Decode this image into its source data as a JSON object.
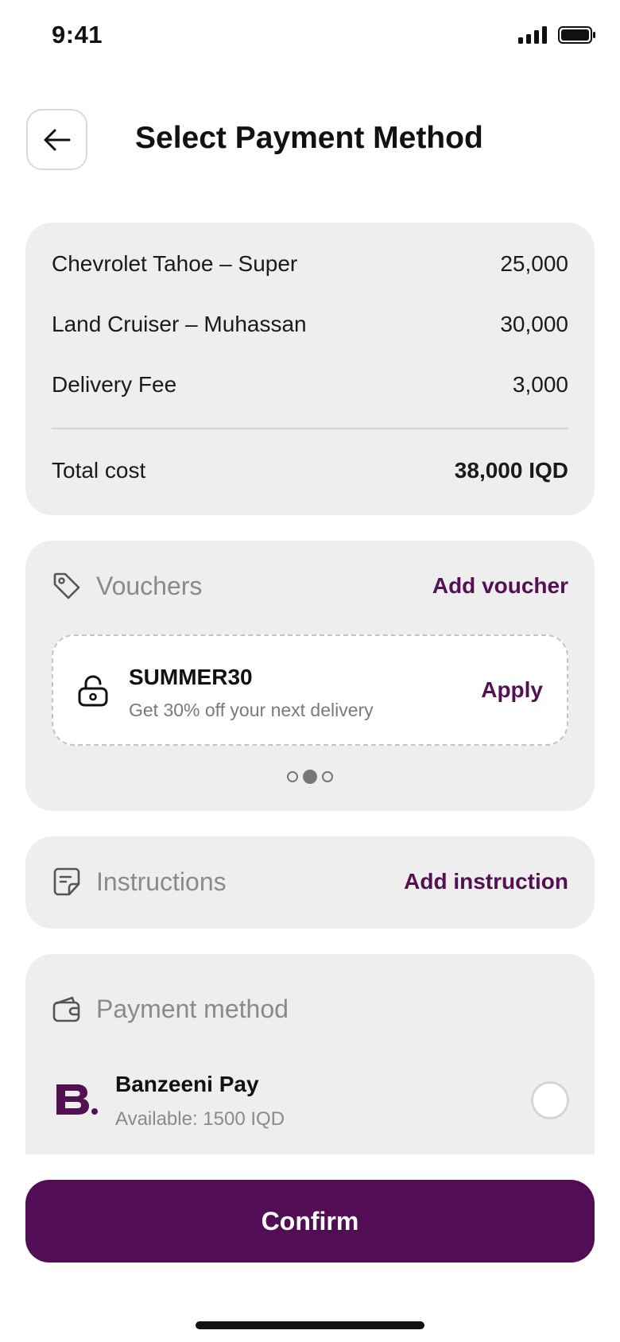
{
  "status_bar": {
    "time": "9:41",
    "signal_icon": "cellular-signal-icon",
    "battery_icon": "battery-icon"
  },
  "header": {
    "title": "Select Payment Method",
    "back_icon": "arrow-left-icon"
  },
  "summary": {
    "items": [
      {
        "label": "Chevrolet Tahoe – Super",
        "value": "25,000"
      },
      {
        "label": "Land Cruiser – Muhassan",
        "value": "30,000"
      },
      {
        "label": "Delivery Fee",
        "value": "3,000"
      }
    ],
    "total_label": "Total cost",
    "total_value": "38,000 IQD"
  },
  "vouchers": {
    "title": "Vouchers",
    "icon": "tag-icon",
    "action": "Add voucher",
    "voucher": {
      "code": "SUMMER30",
      "description": "Get 30% off your next delivery",
      "apply_label": "Apply",
      "icon": "lock-icon"
    },
    "pager": {
      "count": 3,
      "active_index": 1
    }
  },
  "instructions": {
    "title": "Instructions",
    "icon": "note-icon",
    "action": "Add instruction"
  },
  "payment": {
    "title": "Payment method",
    "icon": "wallet-icon",
    "options": [
      {
        "name": "Banzeeni Pay",
        "available": "Available: 1500 IQD",
        "logo": "banzeeni-logo",
        "selected": false
      }
    ]
  },
  "footer": {
    "confirm_label": "Confirm"
  },
  "colors": {
    "brand": "#520d55",
    "card_bg": "#eeeeee",
    "muted_text": "#8a8a8a"
  }
}
